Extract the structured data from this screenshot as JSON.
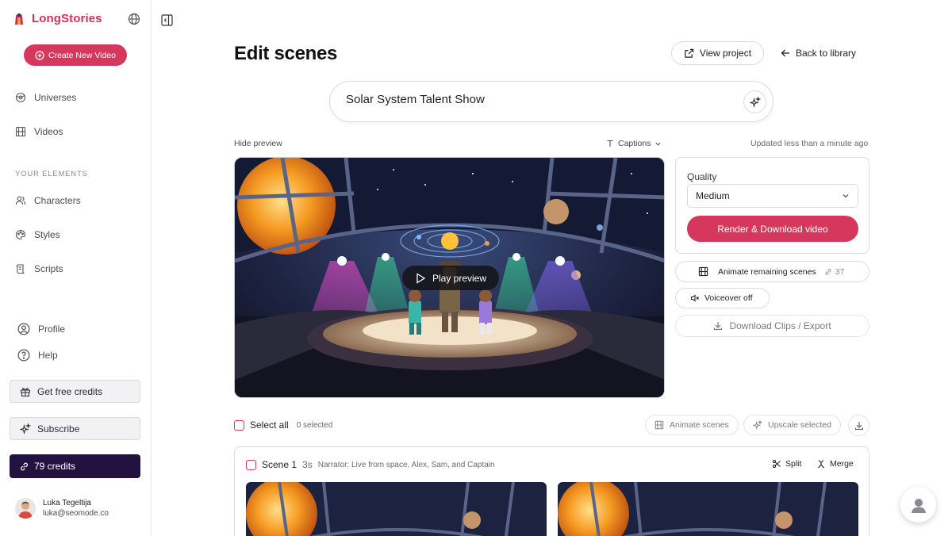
{
  "brand": {
    "name": "LongStories"
  },
  "sidebar": {
    "create_label": "Create New Video",
    "nav": [
      {
        "label": "Universes",
        "icon": "universe-icon"
      },
      {
        "label": "Videos",
        "icon": "film-icon"
      }
    ],
    "section_label": "YOUR ELEMENTS",
    "elements": [
      {
        "label": "Characters",
        "icon": "users-icon"
      },
      {
        "label": "Styles",
        "icon": "palette-icon"
      },
      {
        "label": "Scripts",
        "icon": "script-icon"
      }
    ],
    "secondary": [
      {
        "label": "Profile",
        "icon": "profile-icon"
      },
      {
        "label": "Help",
        "icon": "help-icon"
      }
    ],
    "free_credits_label": "Get free credits",
    "subscribe_label": "Subscribe",
    "credits_label": "79 credits",
    "user": {
      "name": "Luka Tegeltija",
      "email": "luka@seomode.co"
    }
  },
  "header": {
    "title": "Edit scenes",
    "view_project_label": "View project",
    "back_label": "Back to library"
  },
  "project": {
    "title": "Solar System Talent Show"
  },
  "preview_bar": {
    "hide_label": "Hide preview",
    "captions_label": "Captions",
    "updated_text": "Updated less than a minute ago"
  },
  "preview": {
    "play_label": "Play preview"
  },
  "render": {
    "quality_label": "Quality",
    "quality_value": "Medium",
    "render_label": "Render & Download video"
  },
  "actions": {
    "animate_remaining_label": "Animate remaining scenes",
    "animate_remaining_cost": "37",
    "voiceover_label": "Voiceover off",
    "download_label": "Download Clips / Export"
  },
  "selection": {
    "select_all_label": "Select all",
    "selected_text": "0 selected",
    "animate_label": "Animate scenes",
    "upscale_label": "Upscale selected"
  },
  "scenes": [
    {
      "title": "Scene 1",
      "duration": "3s",
      "narration": "Narrator: Live from space, Alex, Sam, and Captain",
      "split_label": "Split",
      "merge_label": "Merge"
    }
  ],
  "colors": {
    "accent": "#d6375c",
    "brand": "#d62f57",
    "credits_bg": "#23113f"
  }
}
